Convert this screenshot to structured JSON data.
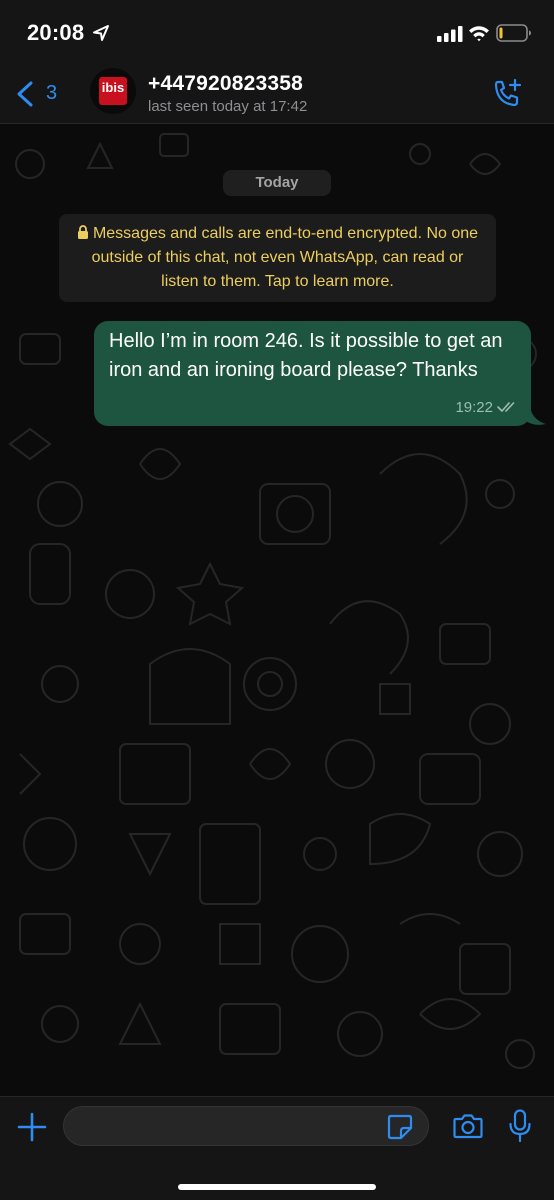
{
  "status_bar": {
    "time": "20:08",
    "location_icon": "location-arrow-icon",
    "signal_icon": "cellular-signal-icon",
    "wifi_icon": "wifi-icon",
    "battery_icon": "battery-icon"
  },
  "header": {
    "back_count": "3",
    "back_icon": "chevron-left-icon",
    "avatar_logo_text": "ibis",
    "contact_name": "+447920823358",
    "contact_status": "last seen today at 17:42",
    "call_icon": "phone-add-icon",
    "accent_color": "#2f8cf0"
  },
  "chat": {
    "date_label": "Today",
    "encryption_notice": "Messages and calls are end-to-end encrypted. No one outside of this chat, not even WhatsApp, can read or listen to them. Tap to learn more.",
    "encryption_icon": "lock-icon",
    "encryption_color": "#ecce5c",
    "messages": [
      {
        "direction": "outgoing",
        "text": "Hello I’m in room 246. Is it possible to get an iron and an ironing board please? Thanks",
        "time": "19:22",
        "status_icon": "double-check-icon",
        "bubble_color": "#1e5541"
      }
    ]
  },
  "input_bar": {
    "placeholder": "",
    "plus_icon": "plus-icon",
    "sticker_icon": "sticker-icon",
    "camera_icon": "camera-icon",
    "mic_icon": "microphone-icon"
  }
}
